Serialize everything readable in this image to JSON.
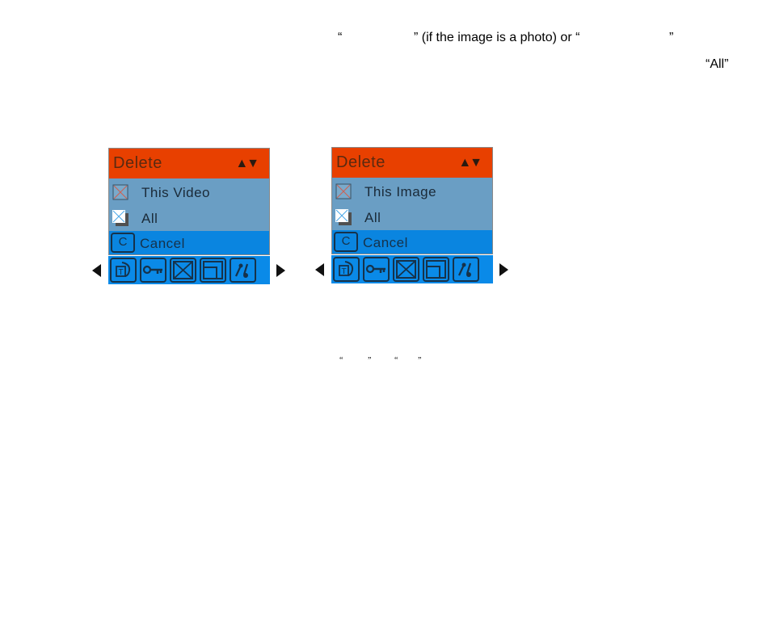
{
  "text": {
    "line1_open_quote": "“",
    "line1_mid": "” (if the image is a photo) or “",
    "line1_close_quote": "”",
    "line2_all": "“All”",
    "line3_quotes": [
      "“",
      "”",
      "“",
      "”"
    ]
  },
  "panels": [
    {
      "header_title": "Delete",
      "header_arrows": "▲▼",
      "items": [
        {
          "label": "This Video",
          "icon": "delete-one-icon"
        },
        {
          "label": "All",
          "icon": "delete-all-icon"
        }
      ],
      "cancel_key": "C",
      "cancel_label": "Cancel",
      "toolbar_icons": [
        "text-rotate-icon",
        "key-icon",
        "delete-icon",
        "frame-icon",
        "tools-icon"
      ],
      "colors": {
        "header": "#E84000",
        "body": "#6A9EC4",
        "selected": "#0A85E0"
      }
    },
    {
      "header_title": "Delete",
      "header_arrows": "▲▼",
      "items": [
        {
          "label": "This  Image",
          "icon": "delete-one-icon"
        },
        {
          "label": "All",
          "icon": "delete-all-icon"
        }
      ],
      "cancel_key": "C",
      "cancel_label": "Cancel",
      "toolbar_icons": [
        "text-rotate-icon",
        "key-icon",
        "delete-icon",
        "frame-icon",
        "tools-icon"
      ],
      "colors": {
        "header": "#E84000",
        "body": "#6A9EC4",
        "selected": "#0A85E0"
      }
    }
  ]
}
